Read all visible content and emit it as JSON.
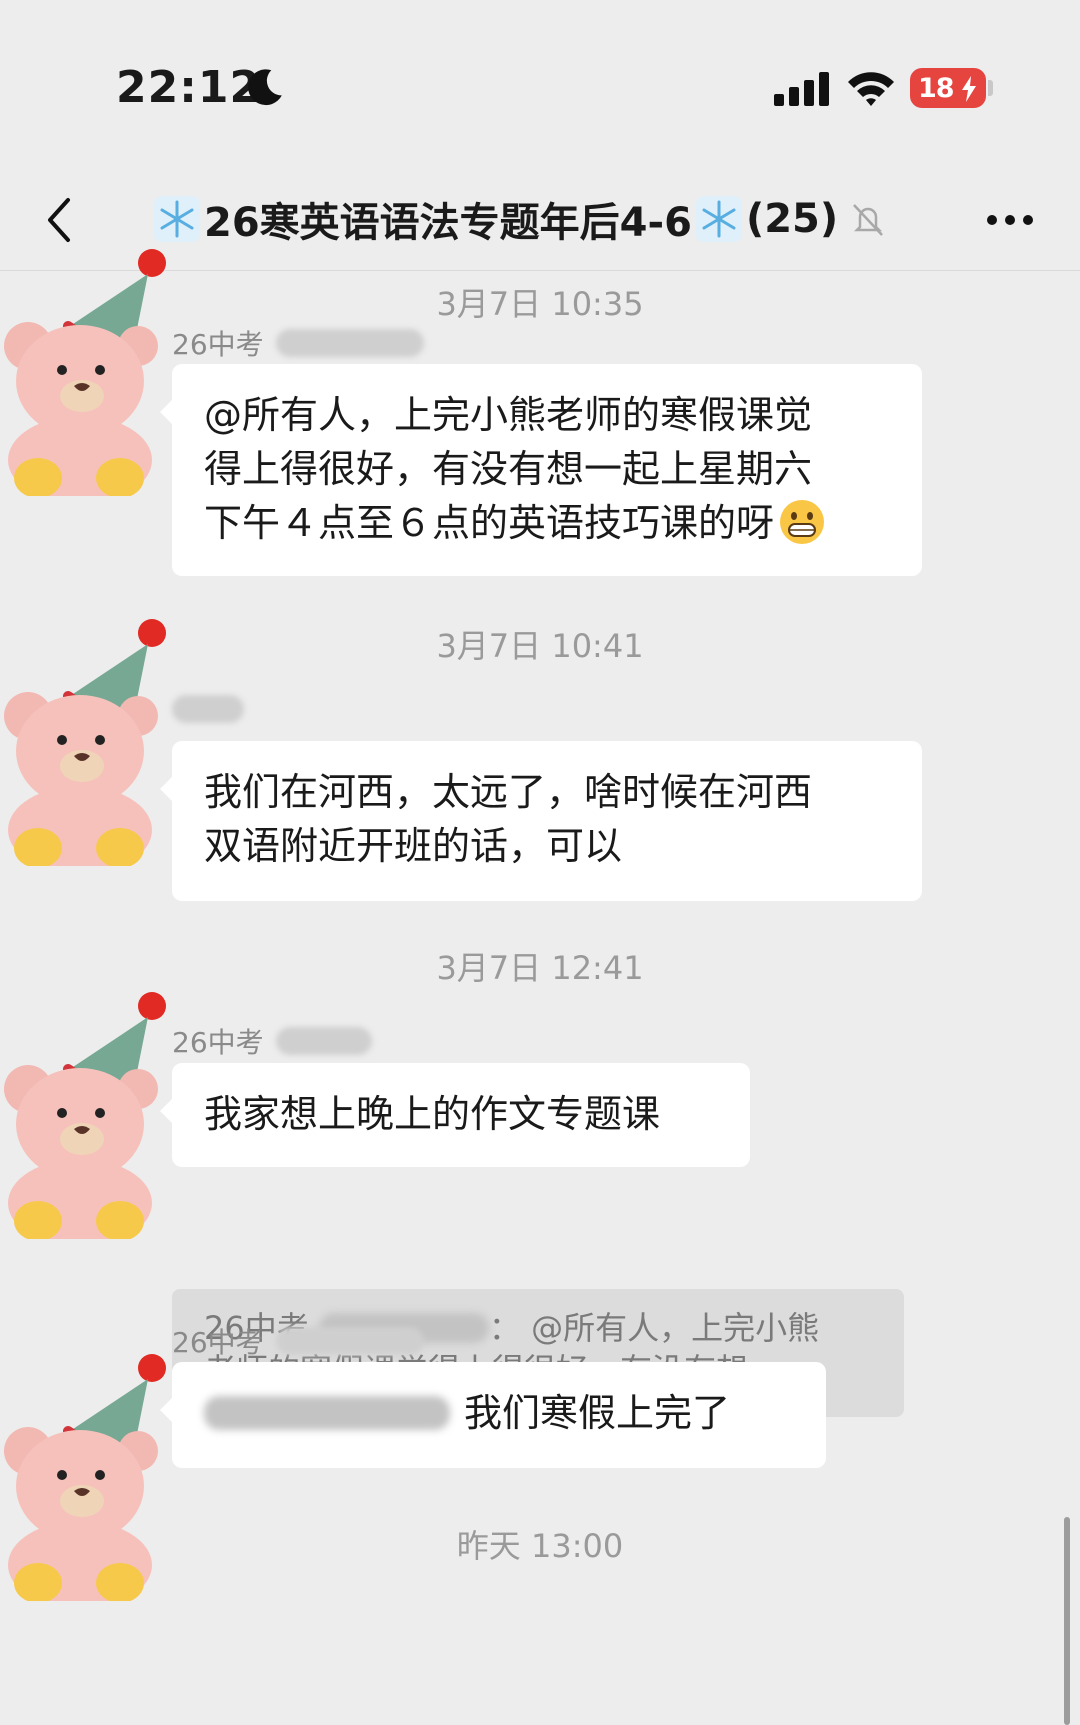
{
  "status_bar": {
    "time": "22:12",
    "battery_level": "18",
    "icons": [
      "moon-icon",
      "signal-icon",
      "wifi-icon",
      "battery-icon"
    ]
  },
  "header": {
    "title_text": "26寒英语语法专题年后4-6",
    "member_count": "(25)",
    "icons": [
      "back-icon",
      "snowflake-icon",
      "mute-bell-icon",
      "more-icon"
    ]
  },
  "timestamps": [
    "3月7日 10:35",
    "3月7日 10:41",
    "3月7日 12:41",
    "昨天 13:00"
  ],
  "messages": [
    {
      "sender": "26中考",
      "lines": [
        "@所有人，上完小熊老师的寒假课觉",
        "得上得很好，有没有想一起上星期六",
        "下午４点至６点的英语技巧课的呀"
      ],
      "emoji": "grinning-face-icon"
    },
    {
      "sender": "",
      "lines": [
        "我们在河西，太远了，啥时候在河西",
        "双语附近开班的话，可以"
      ]
    },
    {
      "sender": "26中考",
      "lines": [
        "我家想上晚上的作文专题课"
      ],
      "quote": {
        "sender": "26中考",
        "line1_text": "@所有人，上完小熊",
        "line2_text": "老师的寒假课觉得上得很好，有没有想一..."
      }
    },
    {
      "sender": "26中考",
      "lines": [
        "我们寒假上完了"
      ]
    }
  ],
  "colors": {
    "background": "#ededed",
    "bubble": "#ffffff",
    "battery": "#e5443f",
    "timestamp_text": "#9a9a9a"
  }
}
